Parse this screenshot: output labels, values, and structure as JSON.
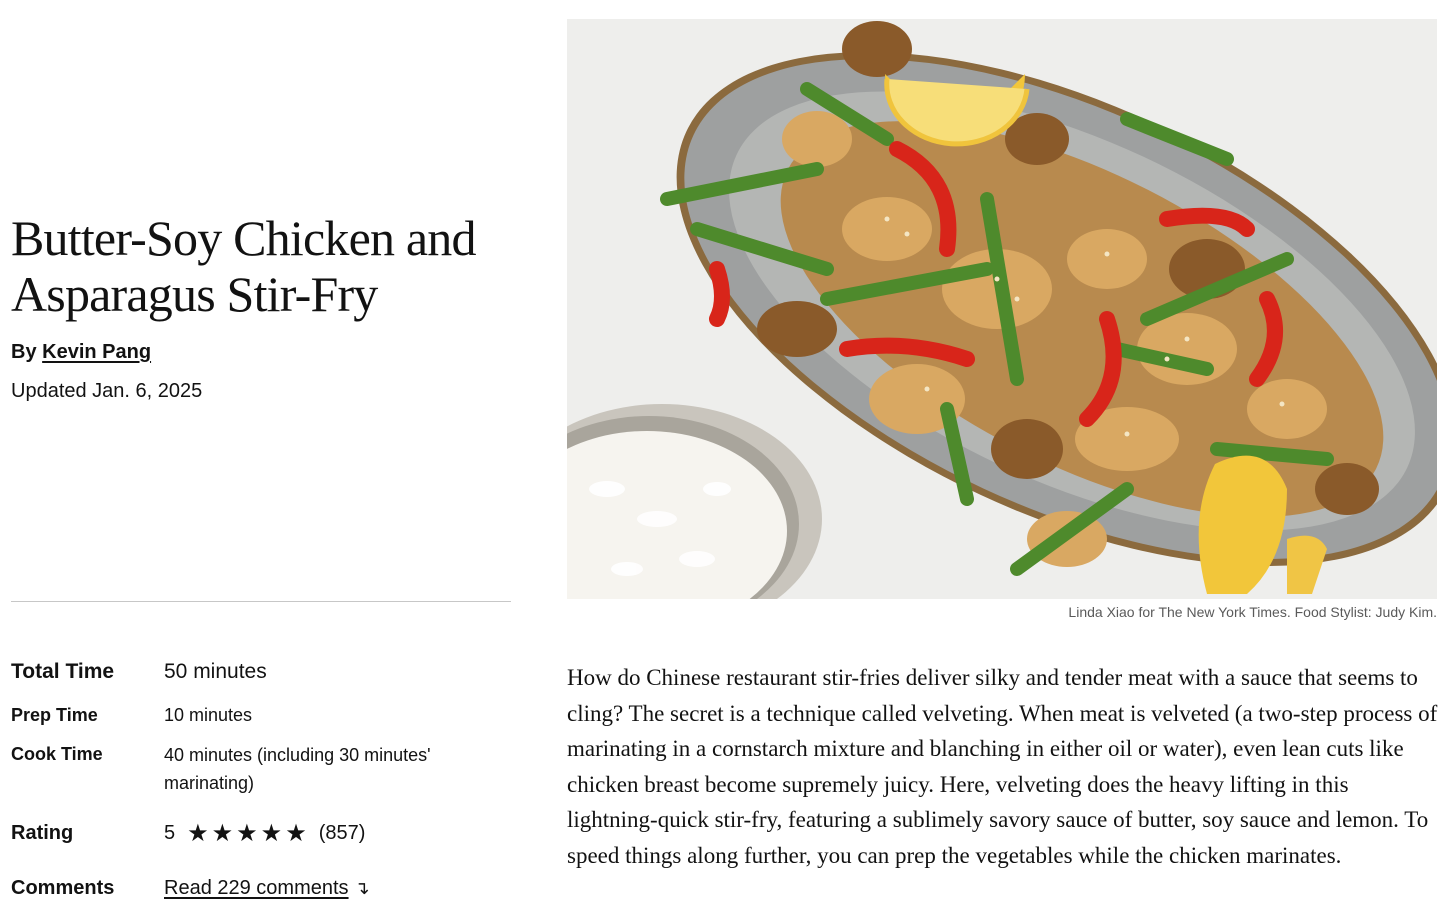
{
  "recipe": {
    "title": "Butter-Soy Chicken and Asparagus Stir-Fry",
    "byline_prefix": "By",
    "author": "Kevin Pang",
    "updated": "Updated Jan. 6, 2025"
  },
  "stats": {
    "total_time": {
      "label": "Total Time",
      "value": "50 minutes"
    },
    "prep_time": {
      "label": "Prep Time",
      "value": "10 minutes"
    },
    "cook_time": {
      "label": "Cook Time",
      "value": "40 minutes (including 30 minutes' marinating)"
    },
    "rating": {
      "label": "Rating",
      "value": "5",
      "stars": 5,
      "count": "(857)"
    },
    "comments": {
      "label": "Comments",
      "link_text": "Read 229 comments",
      "arrow": "↴"
    }
  },
  "photo": {
    "alt_icon": "food-photo",
    "credit": "Linda Xiao for The New York Times. Food Stylist: Judy Kim."
  },
  "intro": "How do Chinese restaurant stir-fries deliver silky and tender meat with a sauce that seems to cling? The secret is a technique called velveting. When meat is velveted (a two-step process of marinating in a cornstarch mixture and blanching in either oil or water), even lean cuts like chicken breast become supremely juicy. Here, velveting does the heavy lifting in this lightning-quick stir-fry, featuring a sublimely savory sauce of butter, soy sauce and lemon. To speed things along further, you can prep the vegetables while the chicken marinates.",
  "colors": {
    "text": "#121212",
    "divider": "#c7c7c7",
    "credit": "#5a5a5a"
  }
}
